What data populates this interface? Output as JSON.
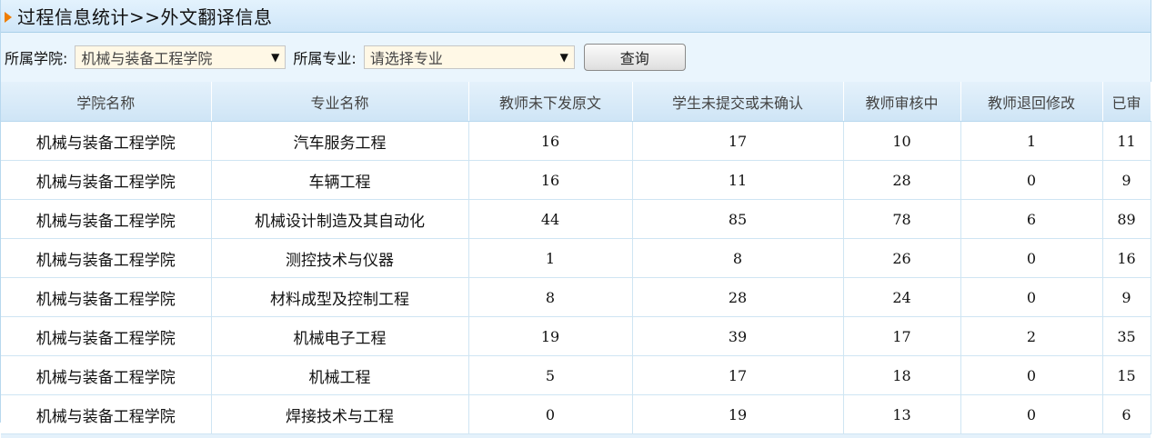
{
  "title": "过程信息统计>>外文翻译信息",
  "filters": {
    "college_label": "所属学院:",
    "college_value": "机械与装备工程学院",
    "major_label": "所属专业:",
    "major_value": "请选择专业",
    "query_button": "查询",
    "dropdown_arrow": "▼"
  },
  "table": {
    "headers": [
      "学院名称",
      "专业名称",
      "教师未下发原文",
      "学生未提交或未确认",
      "教师审核中",
      "教师退回修改",
      "已审"
    ],
    "rows": [
      [
        "机械与装备工程学院",
        "汽车服务工程",
        "16",
        "17",
        "10",
        "1",
        "11"
      ],
      [
        "机械与装备工程学院",
        "车辆工程",
        "16",
        "11",
        "28",
        "0",
        "9"
      ],
      [
        "机械与装备工程学院",
        "机械设计制造及其自动化",
        "44",
        "85",
        "78",
        "6",
        "89"
      ],
      [
        "机械与装备工程学院",
        "测控技术与仪器",
        "1",
        "8",
        "26",
        "0",
        "16"
      ],
      [
        "机械与装备工程学院",
        "材料成型及控制工程",
        "8",
        "28",
        "24",
        "0",
        "9"
      ],
      [
        "机械与装备工程学院",
        "机械电子工程",
        "19",
        "39",
        "17",
        "2",
        "35"
      ],
      [
        "机械与装备工程学院",
        "机械工程",
        "5",
        "17",
        "18",
        "0",
        "15"
      ],
      [
        "机械与装备工程学院",
        "焊接技术与工程",
        "0",
        "19",
        "13",
        "0",
        "6"
      ]
    ]
  },
  "colors": {
    "accent_icon": "#ef7d00",
    "header_bg": "#cfe5f6",
    "page_bg": "#eaf5fd"
  }
}
